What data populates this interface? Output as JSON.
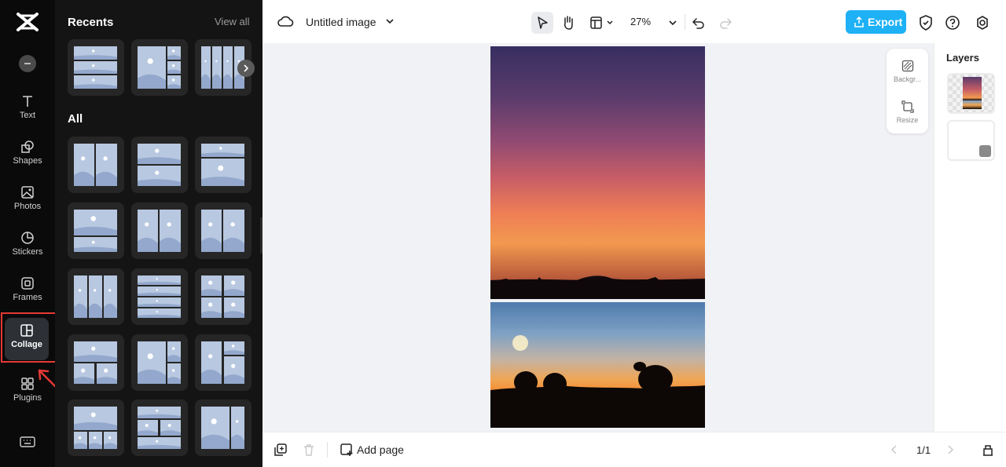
{
  "rail": {
    "items": [
      {
        "key": "text",
        "label": "Text",
        "icon": "text-icon"
      },
      {
        "key": "shapes",
        "label": "Shapes",
        "icon": "shapes-icon"
      },
      {
        "key": "photos",
        "label": "Photos",
        "icon": "photos-icon"
      },
      {
        "key": "stickers",
        "label": "Stickers",
        "icon": "stickers-icon"
      },
      {
        "key": "frames",
        "label": "Frames",
        "icon": "frames-icon"
      },
      {
        "key": "collage",
        "label": "Collage",
        "icon": "collage-icon",
        "active": true
      },
      {
        "key": "plugins",
        "label": "Plugins",
        "icon": "plugins-icon"
      }
    ]
  },
  "panel": {
    "recents_heading": "Recents",
    "view_all_label": "View all",
    "all_heading": "All"
  },
  "topbar": {
    "document_title": "Untitled image",
    "zoom_level": "27%",
    "export_label": "Export"
  },
  "side_tools": {
    "background_label": "Backgr...",
    "resize_label": "Resize"
  },
  "layers": {
    "heading": "Layers"
  },
  "bottombar": {
    "add_page_label": "Add page",
    "page_indicator": "1/1"
  },
  "colors": {
    "rail_bg": "#0a0a0a",
    "panel_bg": "#141414",
    "accent": "#1eb1f5",
    "annotation": "#e53935",
    "canvas_bg": "#f1f2f5"
  }
}
